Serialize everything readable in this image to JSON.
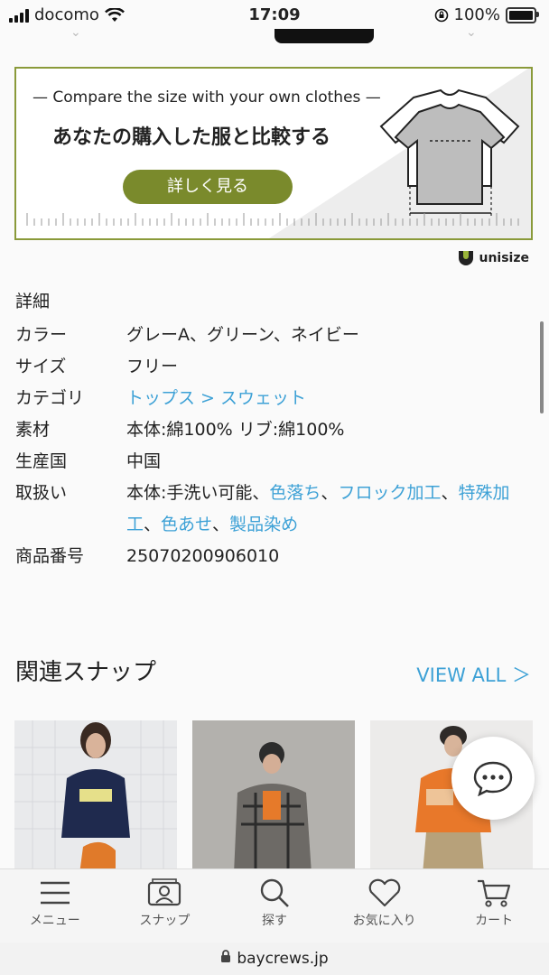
{
  "status": {
    "carrier": "docomo",
    "time": "17:09",
    "battery": "100%"
  },
  "banner": {
    "sub": "— Compare the size with your own clothes —",
    "main": "あなたの購入した服と比較する",
    "button": "詳しく見る"
  },
  "unisize": {
    "label": "unisize"
  },
  "details": {
    "title": "詳細",
    "color_key": "カラー",
    "color_val": "グレーA、グリーン、ネイビー",
    "size_key": "サイズ",
    "size_val": "フリー",
    "category_key": "カテゴリ",
    "category_val": "トップス > スウェット",
    "material_key": "素材",
    "material_val": "本体:綿100% リブ:綿100%",
    "origin_key": "生産国",
    "origin_val": "中国",
    "care_key": "取扱い",
    "care_plain": "本体:手洗い可能、",
    "care_links": [
      "色落ち",
      "フロック加工",
      "特殊加工",
      "色あせ",
      "製品染め"
    ],
    "care_sep": "、",
    "item_no_key": "商品番号",
    "item_no_val": "25070200906010"
  },
  "snaps": {
    "title": "関連スナップ",
    "view_all": "VIEW ALL ＞"
  },
  "tabbar": {
    "menu": "メニュー",
    "snap": "スナップ",
    "search": "探す",
    "fav": "お気に入り",
    "cart": "カート"
  },
  "url": {
    "domain": "baycrews.jp"
  },
  "icons": [
    "signal-icon",
    "wifi-icon",
    "lock-rotation-icon",
    "battery-icon",
    "menu-icon",
    "snap-icon",
    "search-icon",
    "heart-icon",
    "cart-icon",
    "chat-icon",
    "lock-icon"
  ],
  "colors": {
    "accent": "#3da1d6",
    "olive": "#7a8a2c",
    "banner_border": "#8a9a3a"
  }
}
